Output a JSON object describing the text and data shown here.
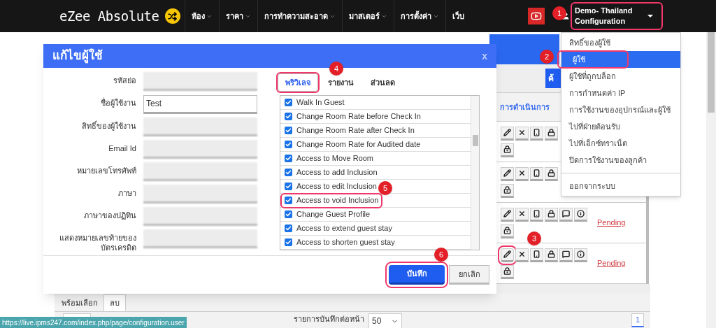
{
  "navbar": {
    "logo": "eZee Absolute",
    "menu": [
      {
        "label": "ห้อง",
        "has_caret": true
      },
      {
        "label": "ราคา",
        "has_caret": true
      },
      {
        "label": "การทำความสะอาด",
        "has_caret": true
      },
      {
        "label": "มาสเตอร์",
        "has_caret": true
      },
      {
        "label": "การตั้งค่า",
        "has_caret": true
      },
      {
        "label": "เว็บ",
        "has_caret": false
      }
    ],
    "user_menu": {
      "lines": [
        "Demo- Thailand",
        "Configuration"
      ],
      "highlighted": true
    }
  },
  "user_dropdown": {
    "items": [
      {
        "label": "สิทธิ์ของผู้ใช้",
        "selected": false,
        "highlighted": false
      },
      {
        "label": "ผู้ใช้",
        "selected": true,
        "highlighted": true
      },
      {
        "label": "ผู้ใช้ที่ถูกบล็อก",
        "selected": false,
        "highlighted": false
      },
      {
        "label": "การกำหนดค่า IP",
        "selected": false,
        "highlighted": false
      },
      {
        "label": "การใช้งานของอุปกรณ์และผู้ใช้",
        "selected": false,
        "highlighted": false
      },
      {
        "label": "ไปที่ฝ่ายต้อนรับ",
        "selected": false,
        "highlighted": false
      },
      {
        "label": "ไปที่เอ็กซ์ทราเน็ต",
        "selected": false,
        "highlighted": false
      },
      {
        "label": "ปิดการใช้งานของลูกค้า",
        "selected": false,
        "highlighted": false
      }
    ],
    "footer_item": "ออกจากระบบ"
  },
  "background_page": {
    "search_button": "ค้",
    "actions_header": "การดำเนินการ",
    "rows": [
      {
        "tools": [
          {
            "kind": "edit"
          },
          {
            "kind": "delete"
          },
          {
            "kind": "device"
          },
          {
            "kind": "lock"
          }
        ],
        "highlighted_edit": false
      },
      {
        "tools": [
          {
            "kind": "edit"
          },
          {
            "kind": "delete"
          },
          {
            "kind": "device"
          },
          {
            "kind": "lock"
          }
        ],
        "highlighted_edit": false
      },
      {
        "tools": [
          {
            "kind": "edit"
          },
          {
            "kind": "delete"
          },
          {
            "kind": "device"
          },
          {
            "kind": "lock"
          },
          {
            "kind": "comment"
          },
          {
            "kind": "info"
          }
        ],
        "status": "Pending",
        "highlighted_edit": false
      },
      {
        "tools": [
          {
            "kind": "edit"
          },
          {
            "kind": "delete"
          },
          {
            "kind": "device"
          },
          {
            "kind": "lock"
          },
          {
            "kind": "comment"
          },
          {
            "kind": "info"
          }
        ],
        "status": "Pending",
        "highlighted_edit": true
      }
    ],
    "bulk_tabs": [
      {
        "label": "พร้อมเลือก",
        "selected": false
      },
      {
        "label": "ลบ",
        "selected": true
      }
    ],
    "per_page_label": "รายการบันทึกต่อหน้า",
    "per_page": "50",
    "page": "1"
  },
  "modal": {
    "title": "แก้ไขผู้ใช้",
    "close": "x",
    "fields": [
      {
        "label": "รหัสย่อ",
        "kind": "blurred"
      },
      {
        "label": "ชื่อผู้ใช้งาน",
        "kind": "text",
        "value": "Test"
      },
      {
        "label": "สิทธิ์ของผู้ใช้งาน",
        "kind": "blurred"
      },
      {
        "label": "Email Id",
        "kind": "blurred"
      },
      {
        "label": "หมายเลขโทรศัพท์",
        "kind": "blurred"
      },
      {
        "label": "ภาษา",
        "kind": "blurred"
      },
      {
        "label": "ภาษาของปฏิทิน",
        "kind": "blurred"
      },
      {
        "label": "แสดงหมายเลขท้ายของบัตรเครดิต",
        "kind": "blurred"
      }
    ],
    "tabs": [
      {
        "label": "พริวิเลจ",
        "selected": true,
        "highlighted": true
      },
      {
        "label": "รายงาน",
        "selected": false,
        "highlighted": false
      },
      {
        "label": "ส่วนลด",
        "selected": false,
        "highlighted": false
      }
    ],
    "permissions": [
      {
        "label": "Walk In Guest",
        "checked": true,
        "highlighted": false
      },
      {
        "label": "Change Room Rate before Check In",
        "checked": true,
        "highlighted": false
      },
      {
        "label": "Change Room Rate after Check In",
        "checked": true,
        "highlighted": false
      },
      {
        "label": "Change Room Rate for Audited date",
        "checked": true,
        "highlighted": false
      },
      {
        "label": "Access to Move Room",
        "checked": true,
        "highlighted": false
      },
      {
        "label": "Access to add Inclusion",
        "checked": true,
        "highlighted": false
      },
      {
        "label": "Access to edit Inclusion",
        "checked": true,
        "highlighted": false
      },
      {
        "label": "Access to void Inclusion",
        "checked": true,
        "highlighted": true
      },
      {
        "label": "Change Guest Profile",
        "checked": true,
        "highlighted": false
      },
      {
        "label": "Access to extend guest stay",
        "checked": true,
        "highlighted": false
      },
      {
        "label": "Access to shorten guest stay",
        "checked": true,
        "highlighted": false
      }
    ],
    "save_button": {
      "label": "บันทึก",
      "highlighted": true
    },
    "cancel_button": "ยกเลิก"
  },
  "callouts": [
    "1",
    "2",
    "3",
    "4",
    "5",
    "6"
  ],
  "status_url": "https://live.ipms247.com/index.php/page/configuration.user"
}
